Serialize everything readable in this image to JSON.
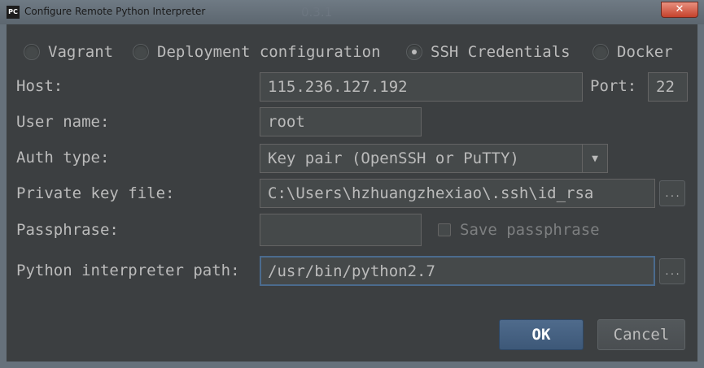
{
  "window": {
    "title": "Configure Remote Python Interpreter",
    "app_icon_text": "PC",
    "background_ghost_text": "0.3.1",
    "close_glyph": "✕"
  },
  "connection_type": {
    "options": [
      {
        "label": "Vagrant",
        "selected": false
      },
      {
        "label": "Deployment configuration",
        "selected": false
      },
      {
        "label": "SSH Credentials",
        "selected": true
      },
      {
        "label": "Docker",
        "selected": false
      }
    ]
  },
  "form": {
    "host_label": "Host:",
    "host_value": "115.236.127.192",
    "port_label": "Port:",
    "port_value": "22",
    "user_label": "User name:",
    "user_value": "root",
    "auth_label": "Auth type:",
    "auth_value": "Key pair (OpenSSH or PuTTY)",
    "key_label": "Private key file:",
    "key_value": "C:\\Users\\hzhuangzhexiao\\.ssh\\id_rsa",
    "passphrase_label": "Passphrase:",
    "passphrase_value": "",
    "save_passphrase_label": "Save passphrase",
    "save_passphrase_checked": false,
    "interpreter_label": "Python interpreter path:",
    "interpreter_value": "/usr/bin/python2.7",
    "browse_label": "...",
    "dropdown_glyph": "▼"
  },
  "buttons": {
    "ok": "OK",
    "cancel": "Cancel"
  },
  "colors": {
    "dialog_bg": "#3c3f41",
    "field_bg": "#45494a",
    "text": "#bbbbbb",
    "focus_border": "#4b6b8e",
    "ok_button": "#4f6b8c"
  }
}
